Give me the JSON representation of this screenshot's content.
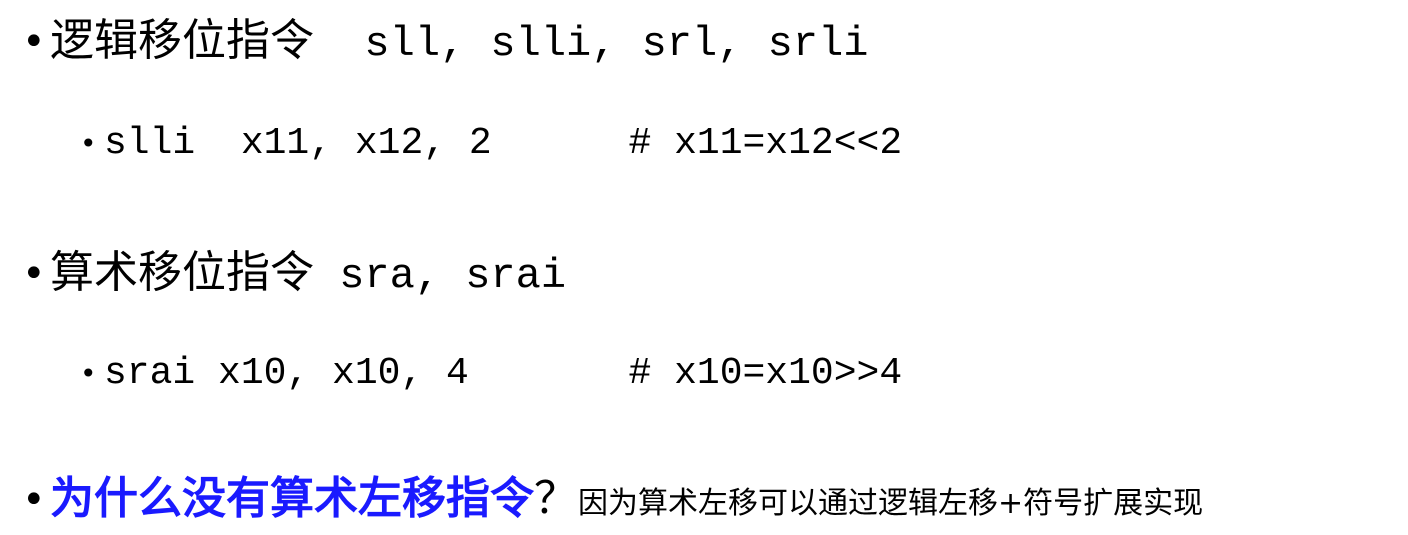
{
  "bullet_char": "•",
  "items": [
    {
      "heading": "逻辑移位指令",
      "code": "  sll, slli, srl, srli"
    },
    {
      "code": "slli  x11, x12, 2      # x11=x12<<2"
    },
    {
      "heading": "算术移位指令",
      "code": " sra, srai"
    },
    {
      "code": "srai x10, x10, 4       # x10=x10>>4"
    },
    {
      "question": "为什么没有算术左移指令",
      "question_mark": "？",
      "answer": "因为算术左移可以通过逻辑左移+符号扩展实现"
    }
  ],
  "colors": {
    "question": "#1a1aff",
    "text": "#000000"
  }
}
